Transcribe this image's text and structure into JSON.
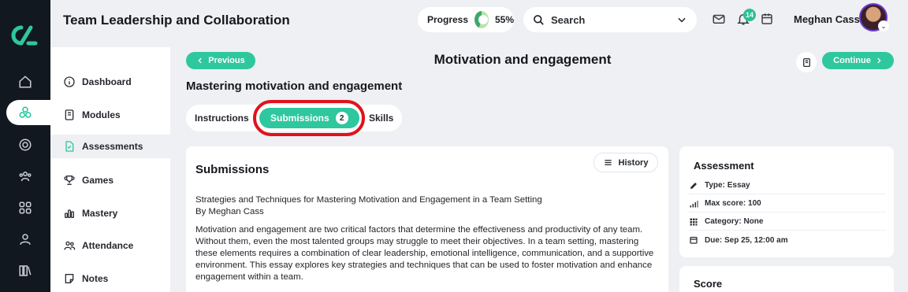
{
  "header": {
    "app_title": "Team Leadership and Collaboration",
    "progress_label": "Progress",
    "progress_value": "55%",
    "progress_fraction": 0.55,
    "search_label": "Search",
    "notification_count": "14",
    "user_name": "Meghan Cass"
  },
  "rail": {
    "icons": [
      "home-icon",
      "modules-icon",
      "target-icon",
      "users-icon",
      "grid-icon",
      "profile-icon",
      "library-icon"
    ],
    "active_index": 1
  },
  "sidebar": {
    "items": [
      {
        "label": "Dashboard",
        "icon": "info-icon"
      },
      {
        "label": "Modules",
        "icon": "book-icon"
      },
      {
        "label": "Assessments",
        "icon": "file-icon",
        "active": true
      },
      {
        "label": "Games",
        "icon": "trophy-icon"
      },
      {
        "label": "Mastery",
        "icon": "chart-bars-icon"
      },
      {
        "label": "Attendance",
        "icon": "group-icon"
      },
      {
        "label": "Notes",
        "icon": "note-icon"
      }
    ]
  },
  "page": {
    "previous_label": "Previous",
    "continue_label": "Continue",
    "title": "Motivation and engagement",
    "subheading": "Mastering motivation and engagement"
  },
  "tabs": [
    {
      "label": "Instructions"
    },
    {
      "label": "Submissions",
      "count": "2",
      "active": true
    },
    {
      "label": "Skills"
    }
  ],
  "submissions": {
    "title": "Submissions",
    "history_label": "History",
    "essay_title": "Strategies and Techniques for Mastering Motivation and Engagement in a Team Setting",
    "essay_author": "By Meghan Cass",
    "essay_body": "Motivation and engagement are two critical factors that determine the effectiveness and productivity of any team. Without them, even the most talented groups may struggle to meet their objectives. In a team setting, mastering these elements requires a combination of clear leadership, emotional intelligence, communication, and a supportive environment. This essay explores key strategies and techniques that can be used to foster motivation and enhance engagement within a team."
  },
  "assessment": {
    "title": "Assessment",
    "type": "Type: Essay",
    "max_score": "Max score: 100",
    "category": "Category: None",
    "due": "Due: Sep 25, 12:00 am"
  },
  "score": {
    "title": "Score"
  },
  "colors": {
    "accent": "#2ec79e",
    "rail": "#121820",
    "highlight": "#e0121b"
  }
}
